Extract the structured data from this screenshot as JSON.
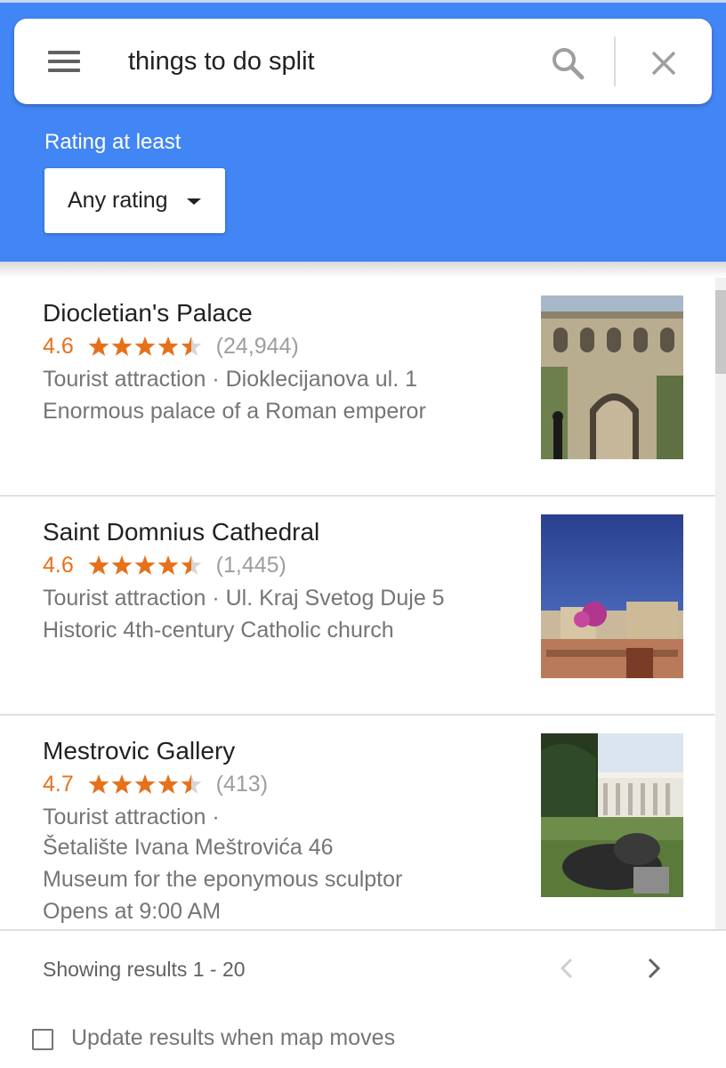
{
  "search": {
    "query": "things to do split",
    "menu_icon": "hamburger-menu-icon",
    "search_icon": "search-icon",
    "close_icon": "close-icon"
  },
  "filter": {
    "label": "Rating at least",
    "selected": "Any rating"
  },
  "colors": {
    "header_blue": "#4285f4",
    "rating_orange": "#e7711b",
    "star_empty": "#d5d5d5",
    "secondary_text": "#757575"
  },
  "results": [
    {
      "title": "Diocletian's Palace",
      "rating": "4.6",
      "stars": 4.5,
      "count": "(24,944)",
      "lines": [
        "Tourist attraction · Dioklecijanova ul. 1",
        "Enormous palace of a Roman emperor"
      ]
    },
    {
      "title": "Saint Domnius Cathedral",
      "rating": "4.6",
      "stars": 4.5,
      "count": "(1,445)",
      "lines": [
        "Tourist attraction · Ul. Kraj Svetog Duje 5",
        "Historic 4th-century Catholic church"
      ]
    },
    {
      "title": "Mestrovic Gallery",
      "rating": "4.7",
      "stars": 4.5,
      "count": "(413)",
      "lines": [
        "Tourist attraction ·",
        "Šetalište Ivana Meštrovića 46",
        "Museum for the eponymous sculptor",
        "Opens at 9:00 AM"
      ]
    }
  ],
  "footer": {
    "showing": "Showing results 1 - 20",
    "prev_icon": "chevron-left-icon",
    "next_icon": "chevron-right-icon",
    "update_label": "Update results when map moves",
    "update_checked": false
  }
}
